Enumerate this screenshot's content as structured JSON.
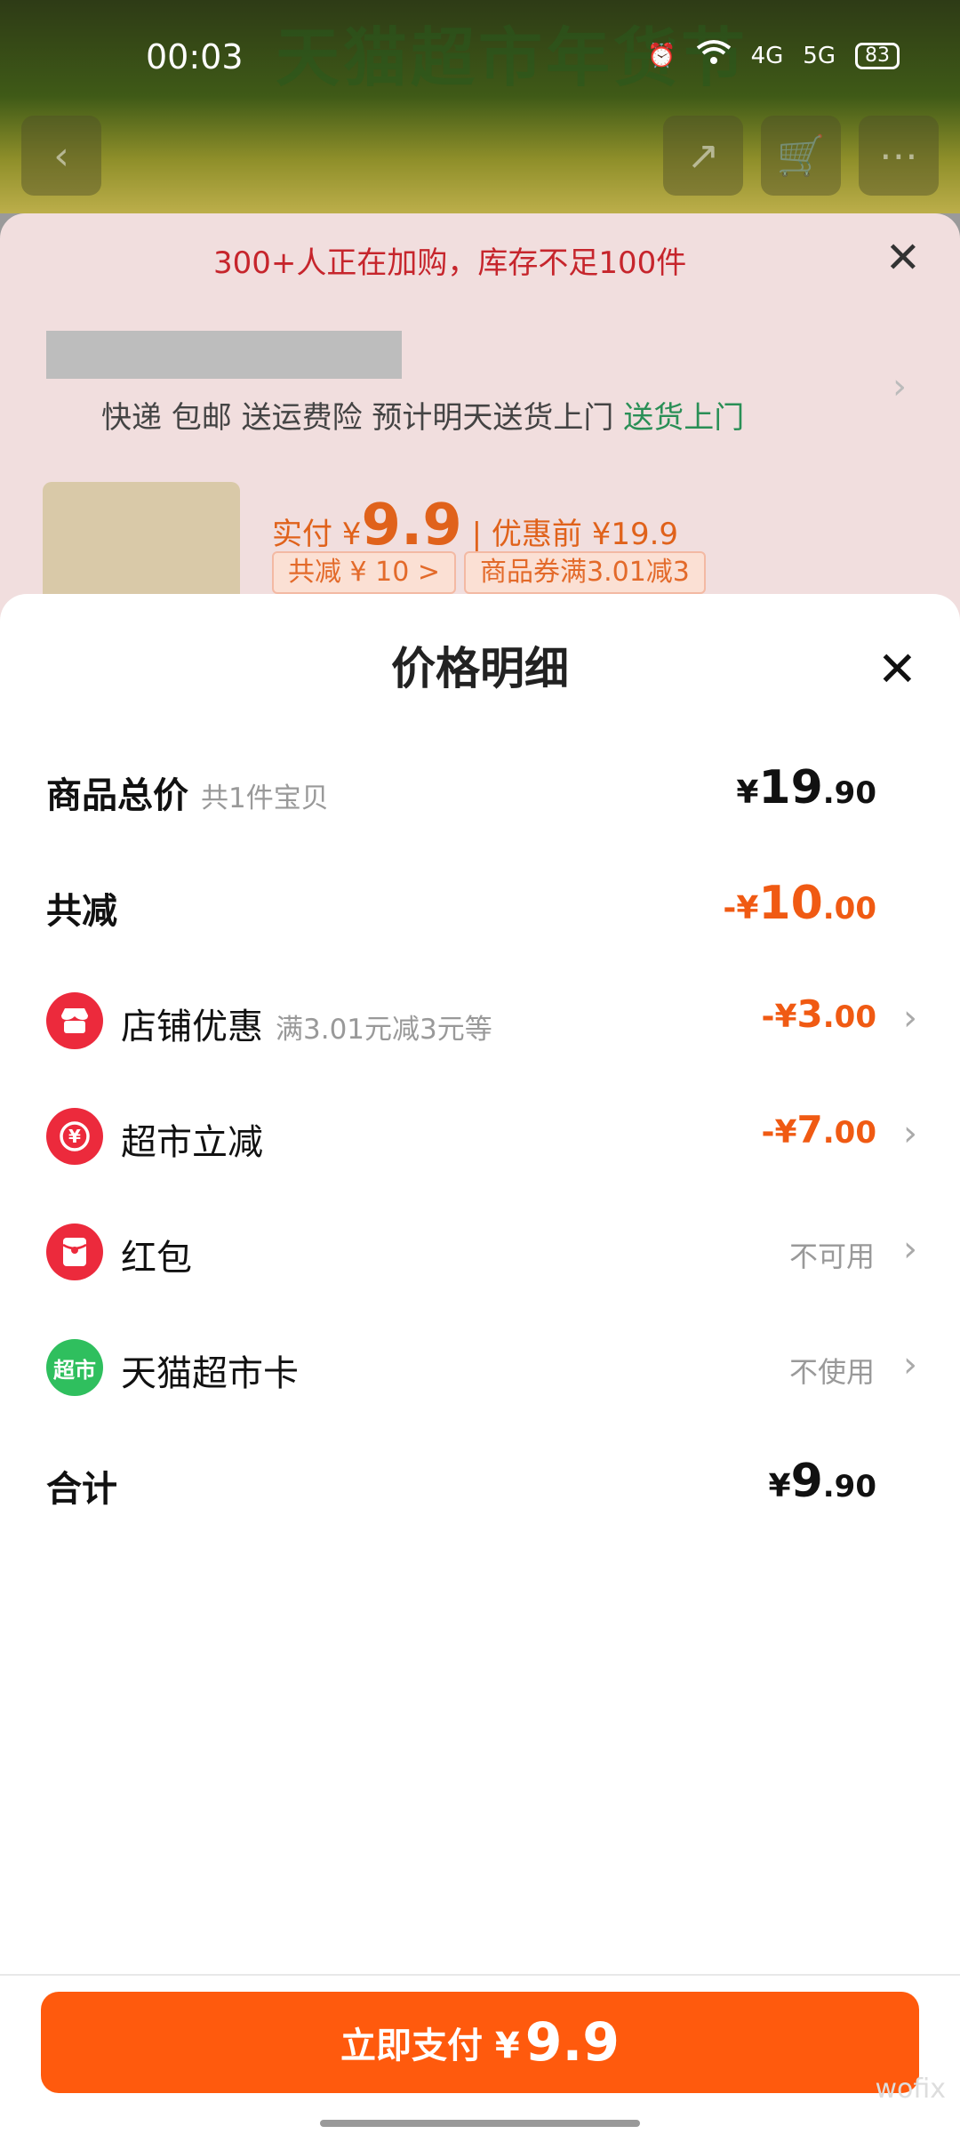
{
  "status": {
    "time": "00:03",
    "network_a": "4G",
    "network_b": "5G",
    "battery": "83"
  },
  "background": {
    "banner_title": "天猫超市年货节",
    "stock_notice": "300+人正在加购，库存不足100件",
    "shipping_text": "快递 包邮 送运费险 预计明天送货上门",
    "shipping_highlight": "送货上门",
    "price_prefix": "实付 ¥",
    "price_value": "9.9",
    "price_before": "| 优惠前 ¥19.9",
    "tag_discount": "共减 ¥ 10 >",
    "tag_coupon": "商品券满3.01减3"
  },
  "sheet": {
    "title": "价格明细",
    "items_total": {
      "label": "商品总价",
      "sub": "共1件宝贝",
      "yen": "¥",
      "int": "19",
      "dec": ".90"
    },
    "total_reduction": {
      "label": "共减",
      "yen": "-¥",
      "int": "10",
      "dec": ".00"
    },
    "shop_discount": {
      "label": "店铺优惠",
      "sub": "满3.01元减3元等",
      "yen": "-¥",
      "int": "3",
      "dec": ".00"
    },
    "market_discount": {
      "label": "超市立减",
      "yen": "-¥",
      "int": "7",
      "dec": ".00"
    },
    "red_packet": {
      "label": "红包",
      "status": "不可用"
    },
    "tmall_card": {
      "label": "天猫超市卡",
      "status": "不使用",
      "icon_text": "超市"
    },
    "grand_total": {
      "label": "合计",
      "yen": "¥",
      "int": "9",
      "dec": ".90"
    }
  },
  "pay_button": {
    "label": "立即支付 ¥",
    "amount": "9.9"
  },
  "watermark": "wofix",
  "colors": {
    "accent": "#ff5a0d",
    "discount": "#f05a13",
    "icon_red": "#ec2a3c",
    "icon_green": "#2fbf5e"
  },
  "icons": {
    "shop_discount": "shop-icon",
    "market_discount": "yen-coupon-icon",
    "red_packet": "red-packet-icon",
    "tmall_card": "market-card-icon"
  }
}
